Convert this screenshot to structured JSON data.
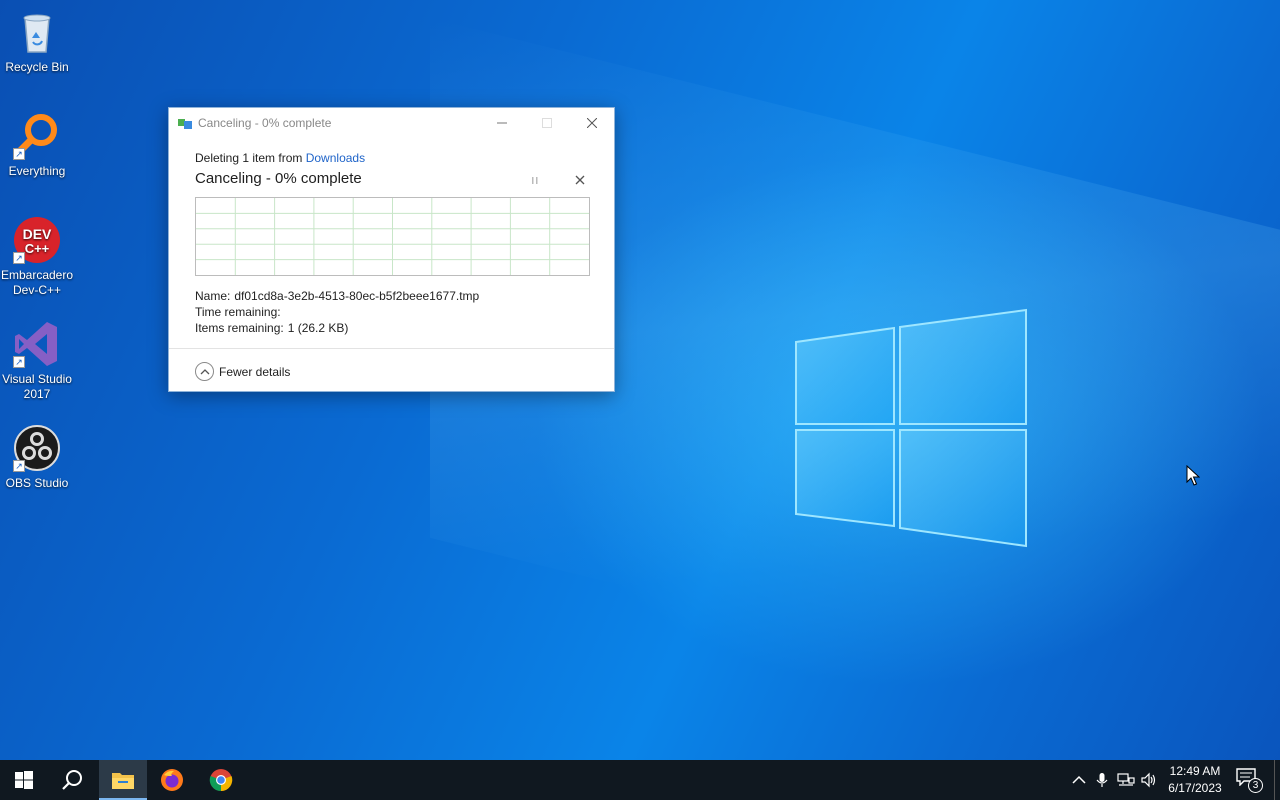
{
  "desktop": {
    "icons": [
      {
        "label": "Recycle Bin",
        "icon": "recycle-bin-icon"
      },
      {
        "label": "Everything",
        "icon": "everything-search-icon"
      },
      {
        "label": "Embarcadero Dev-C++",
        "icon": "devcpp-icon",
        "icon_text_1": "DEV",
        "icon_text_2": "C++"
      },
      {
        "label": "Visual Studio 2017",
        "icon": "visual-studio-icon"
      },
      {
        "label": "OBS Studio",
        "icon": "obs-studio-icon"
      }
    ]
  },
  "dialog": {
    "title": "Canceling - 0% complete",
    "line1_prefix": "Deleting 1 item from ",
    "line1_link": "Downloads",
    "heading": "Canceling - 0% complete",
    "progress_percent": 0,
    "name_label": "Name:",
    "name_value": "df01cd8a-3e2b-4513-80ec-b5f2beee1677.tmp",
    "time_label": "Time remaining:",
    "time_value": "",
    "items_label": "Items remaining:",
    "items_value": "1 (26.2 KB)",
    "fewer_details": "Fewer details",
    "colors": {
      "link": "#1f64c9",
      "graph_grid": "#c8e6c8"
    }
  },
  "taskbar": {
    "buttons": [
      {
        "name": "start-button",
        "icon": "windows-logo-icon"
      },
      {
        "name": "search-button",
        "icon": "search-icon"
      },
      {
        "name": "file-explorer-button",
        "icon": "folder-icon",
        "active": true
      },
      {
        "name": "firefox-button",
        "icon": "firefox-icon"
      },
      {
        "name": "chrome-button",
        "icon": "chrome-icon"
      }
    ],
    "tray": [
      "chevron-up-icon",
      "microphone-icon",
      "network-icon",
      "speaker-icon"
    ],
    "time": "12:49 AM",
    "date": "6/17/2023",
    "notification_count": "3"
  }
}
